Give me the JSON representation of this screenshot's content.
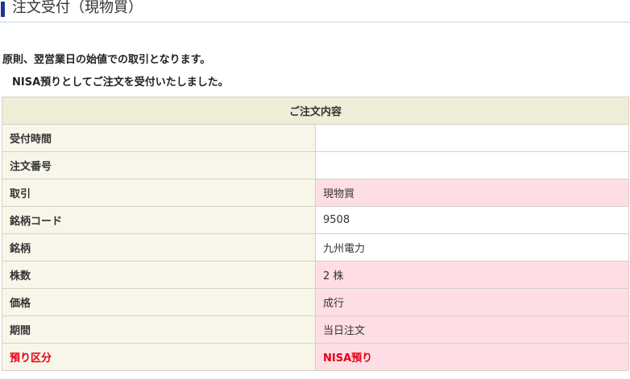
{
  "page": {
    "title": "注文受付（現物買）"
  },
  "notices": [
    "原則、翌営業日の始値での取引となります。",
    "NISA預りとしてご注文を受付いたしました。"
  ],
  "order_table": {
    "header": "ご注文内容",
    "rows": [
      {
        "label": "受付時間",
        "value": ""
      },
      {
        "label": "注文番号",
        "value": ""
      },
      {
        "label": "取引",
        "value": "現物買"
      },
      {
        "label": "銘柄コード",
        "value": "9508"
      },
      {
        "label": "銘柄",
        "value": "九州電力"
      },
      {
        "label": "株数",
        "value": "2 株"
      },
      {
        "label": "価格",
        "value": "成行"
      },
      {
        "label": "期間",
        "value": "当日注文"
      },
      {
        "label": "預り区分",
        "value": "NISA預り"
      }
    ]
  },
  "colors": {
    "accent_bar": "#1a3b8f",
    "header_bg": "#efecd8",
    "label_bg": "#f7f6e9",
    "highlight_bg": "#ffdde4",
    "alert_text": "#e60012"
  }
}
